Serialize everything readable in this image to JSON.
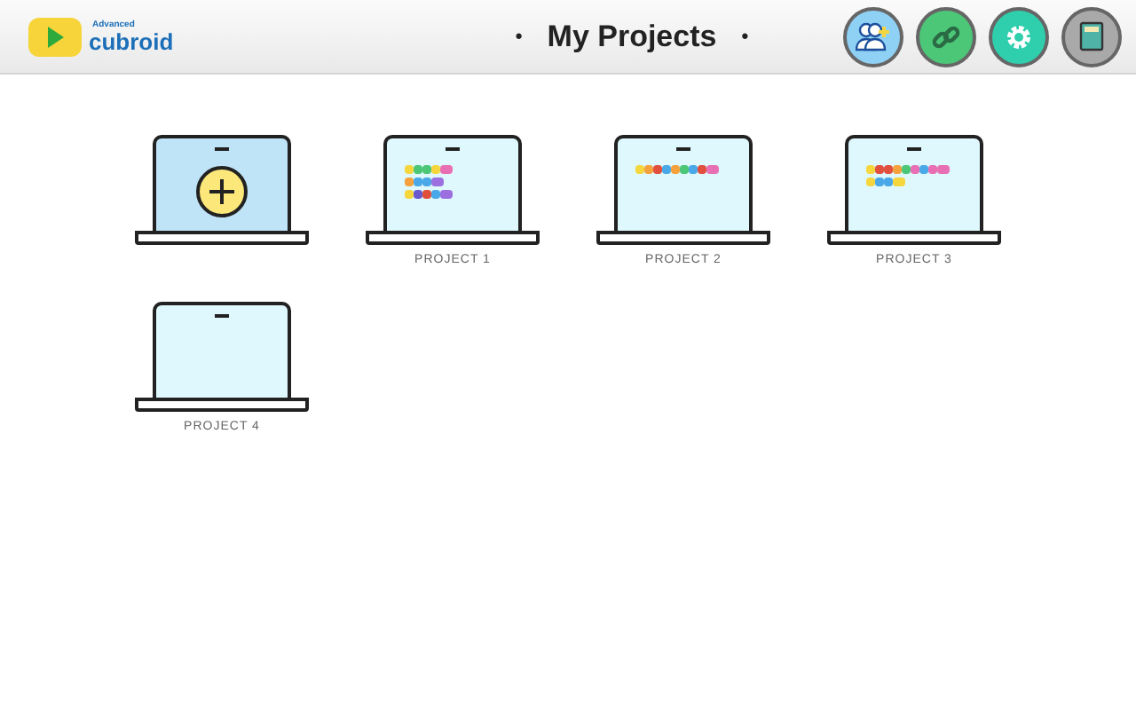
{
  "header": {
    "logo_small": "Advanced",
    "logo_name": "cubroid",
    "title": "My Projects",
    "title_marks": [
      "•",
      "•"
    ],
    "buttons": [
      {
        "kind": "users",
        "color": "#8fd0f5"
      },
      {
        "kind": "link",
        "color": "#4cc777"
      },
      {
        "kind": "settings",
        "color": "#2fcfae"
      },
      {
        "kind": "book",
        "color": "#a9a9a9"
      }
    ]
  },
  "projects": [
    {
      "kind": "new"
    },
    {
      "kind": "project",
      "label": "PROJECT 1",
      "code_rows": [
        {
          "blocks": [
            {
              "color": "#f5d63d"
            },
            {
              "color": "#4cc777"
            },
            {
              "color": "#4cc777"
            },
            {
              "color": "#f5d63d"
            },
            {
              "color": "#e86fb3"
            }
          ]
        },
        {
          "blocks": [
            {
              "color": "#f5a23d"
            },
            {
              "color": "#49a8e8"
            },
            {
              "color": "#49a8e8"
            },
            {
              "color": "#9c6fe0"
            }
          ]
        },
        {
          "blocks": [
            {
              "color": "#f5d63d"
            },
            {
              "color": "#6a5acd"
            },
            {
              "color": "#e0503d"
            },
            {
              "color": "#49a8e8"
            },
            {
              "color": "#9c6fe0"
            }
          ]
        }
      ]
    },
    {
      "kind": "project",
      "label": "PROJECT 2",
      "code_rows": [
        {
          "blocks": [
            {
              "color": "#f5d63d"
            },
            {
              "color": "#f5a23d"
            },
            {
              "color": "#e0503d"
            },
            {
              "color": "#49a8e8"
            },
            {
              "color": "#f5a23d"
            },
            {
              "color": "#4cc777"
            },
            {
              "color": "#49a8e8"
            },
            {
              "color": "#e0503d"
            },
            {
              "color": "#e86fb3"
            }
          ]
        }
      ]
    },
    {
      "kind": "project",
      "label": "PROJECT 3",
      "code_rows": [
        {
          "blocks": [
            {
              "color": "#f5d63d"
            },
            {
              "color": "#e0503d"
            },
            {
              "color": "#e0503d"
            },
            {
              "color": "#f5a23d"
            },
            {
              "color": "#4cc777"
            },
            {
              "color": "#e86fb3"
            },
            {
              "color": "#49a8e8"
            },
            {
              "color": "#e86fb3"
            },
            {
              "color": "#e86fb3"
            }
          ]
        },
        {
          "blocks": [
            {
              "color": "#f5d63d"
            },
            {
              "color": "#49a8e8"
            },
            {
              "color": "#49a8e8"
            },
            {
              "color": "#f5d63d"
            }
          ]
        }
      ]
    },
    {
      "kind": "project",
      "label": "PROJECT 4"
    }
  ]
}
